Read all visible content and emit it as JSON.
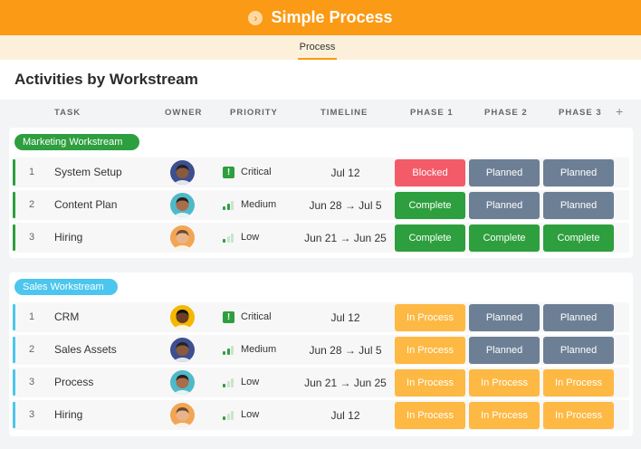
{
  "app": {
    "title": "Simple Process",
    "logo_icon": "chevron-right-icon"
  },
  "tabs": [
    {
      "label": "Process",
      "active": true
    }
  ],
  "page_title": "Activities by Workstream",
  "columns": {
    "task": "TASK",
    "owner": "OWNER",
    "priority": "PRIORITY",
    "timeline": "TIMELINE",
    "phase1": "PHASE 1",
    "phase2": "PHASE 2",
    "phase3": "PHASE 3",
    "add": "+"
  },
  "colors": {
    "brand": "#fb9a14",
    "marketing": "#2e9f3e",
    "sales": "#4cc6ee",
    "blocked": "#f45b69",
    "planned": "#6c7f95",
    "complete": "#2e9f3e",
    "in_process": "#fdb944"
  },
  "groups": [
    {
      "name": "Marketing Workstream",
      "rows": [
        {
          "num": "1",
          "task": "System Setup",
          "priority": "Critical",
          "priority_icon": "exclamation-icon",
          "timeline": "Jul 12",
          "phases": [
            "Blocked",
            "Planned",
            "Planned"
          ]
        },
        {
          "num": "2",
          "task": "Content Plan",
          "priority": "Medium",
          "priority_icon": "signal-bars-icon",
          "timeline": "Jun 28 → Jul 5",
          "phases": [
            "Complete",
            "Planned",
            "Planned"
          ]
        },
        {
          "num": "3",
          "task": "Hiring",
          "priority": "Low",
          "priority_icon": "signal-bars-icon",
          "timeline": "Jun 21 → Jun 25",
          "phases": [
            "Complete",
            "Complete",
            "Complete"
          ]
        }
      ]
    },
    {
      "name": "Sales Workstream",
      "rows": [
        {
          "num": "1",
          "task": "CRM",
          "priority": "Critical",
          "priority_icon": "exclamation-icon",
          "timeline": "Jul 12",
          "phases": [
            "In Process",
            "Planned",
            "Planned"
          ]
        },
        {
          "num": "2",
          "task": "Sales Assets",
          "priority": "Medium",
          "priority_icon": "signal-bars-icon",
          "timeline": "Jun 28 → Jul 5",
          "phases": [
            "In Process",
            "Planned",
            "Planned"
          ]
        },
        {
          "num": "3",
          "task": "Process",
          "priority": "Low",
          "priority_icon": "signal-bars-icon",
          "timeline": "Jun 21 → Jun 25",
          "phases": [
            "In Process",
            "In Process",
            "In Process"
          ]
        },
        {
          "num": "3",
          "task": "Hiring",
          "priority": "Low",
          "priority_icon": "signal-bars-icon",
          "timeline": "Jul 12",
          "phases": [
            "In Process",
            "In Process",
            "In Process"
          ]
        }
      ]
    }
  ]
}
